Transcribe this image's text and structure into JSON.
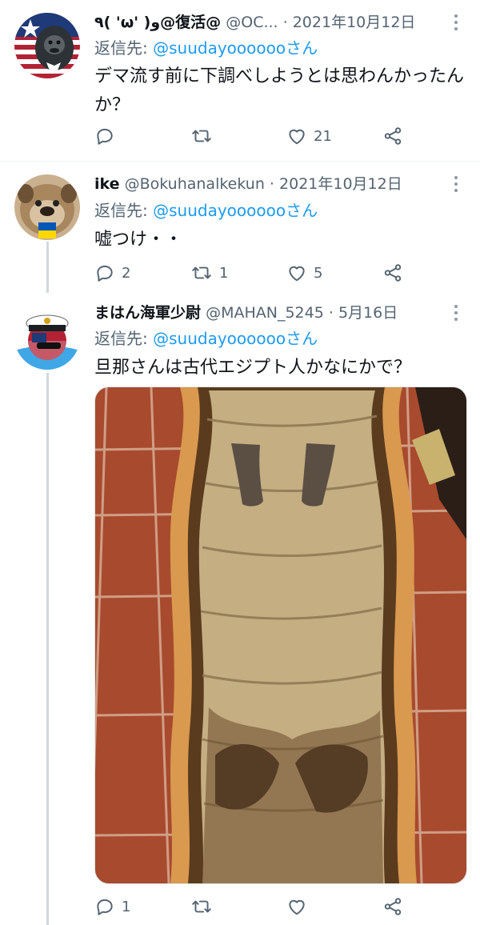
{
  "tweets": [
    {
      "name": "٩( 'ω' )و@復活@",
      "handle": "@OC...",
      "dot": "·",
      "date": "2021年10月12日",
      "reply_prefix": "返信先: ",
      "reply_mention": "@suudayoooooo",
      "reply_suffix": "さん",
      "text": "デマ流す前に下調べしようとは思わんかったんか？",
      "likes": "21",
      "retweets": "",
      "replies": ""
    },
    {
      "name": "ike",
      "handle": "@Bokuhanalkekun",
      "dot": "·",
      "date": "2021年10月12日",
      "reply_prefix": "返信先: ",
      "reply_mention": "@suudayoooooo",
      "reply_suffix": "さん",
      "text": "嘘つけ・・",
      "replies": "2",
      "retweets": "1",
      "likes": "5"
    },
    {
      "name": "まはん海軍少尉",
      "handle": "@MAHAN_5245",
      "dot": "·",
      "date": "5月16日",
      "reply_prefix": "返信先: ",
      "reply_mention": "@suudayoooooo",
      "reply_suffix": "さん",
      "text": "旦那さんは古代エジプト人かなにかで？",
      "replies": "1",
      "retweets": "",
      "likes": ""
    }
  ],
  "icons": {
    "reply": "reply-icon",
    "retweet": "retweet-icon",
    "like": "heart-icon",
    "share": "share-icon",
    "more": "more-icon"
  },
  "colors": {
    "mention": "#1d9bf0",
    "secondary_text": "#536471",
    "thread_line": "#cfd9de"
  }
}
